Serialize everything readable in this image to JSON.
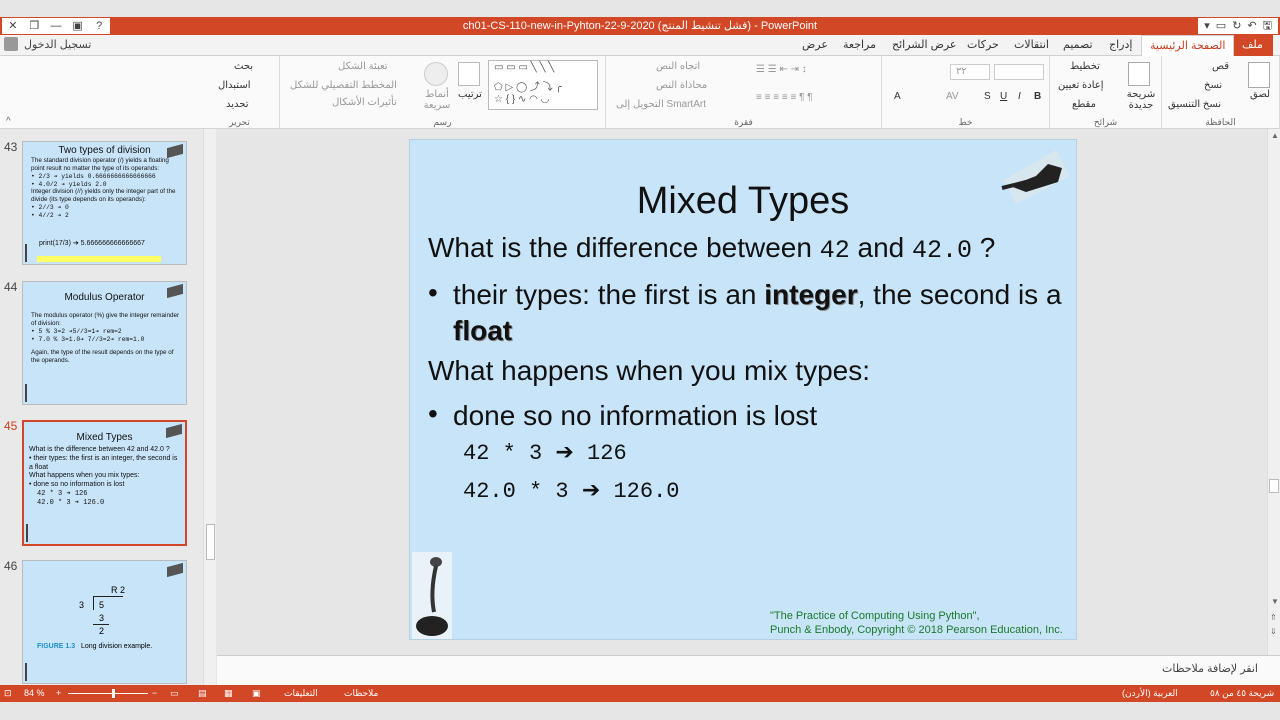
{
  "window": {
    "title": "ch01-CS-110-new-in-Pyhton-22-9-2020  (فشل تنشيط المنتج)  -  PowerPoint",
    "controls": [
      "✕",
      "❐",
      "—",
      "▢",
      "?"
    ]
  },
  "signin": "تسجيل الدخول",
  "tabs": {
    "file": "ملف",
    "home": "الصفحة الرئيسية",
    "insert": "إدراج",
    "design": "تصميم",
    "transitions": "انتقالات",
    "animations": "حركات",
    "slideshow": "عرض الشرائح",
    "review": "مراجعة",
    "view": "عرض"
  },
  "ribbon": {
    "clipboard": {
      "label": "الحافظة",
      "paste": "لصق",
      "cut": "قص",
      "copy": "نسخ",
      "format_painter": "نسخ التنسيق"
    },
    "slides": {
      "label": "شرائح",
      "new_slide": "شريحة جديدة",
      "layout": "تخطيط",
      "reset": "إعادة تعيين",
      "section": "مقطع"
    },
    "font": {
      "label": "خط",
      "size": "٣٢"
    },
    "paragraph": {
      "label": "فقرة",
      "text_direction": "اتجاه النص",
      "align_text": "محاذاة النص",
      "smartart": "التحويل إلى SmartArt"
    },
    "drawing": {
      "label": "رسم",
      "arrange": "ترتيب",
      "quick_styles": "أنماط سريعة",
      "shape_fill": "تعبئة الشكل",
      "shape_outline": "المخطط التفصيلي للشكل",
      "shape_effects": "تأثيرات الأشكال"
    },
    "editing": {
      "label": "تحرير",
      "find": "بحث",
      "replace": "استبدال",
      "select": "تحديد"
    }
  },
  "thumbnails": [
    {
      "number": "43",
      "title": "Two types of division",
      "lines": [
        "The standard division operator (/) yields a floating point result no matter the type of its operands:",
        "• 2/3      ➔ yields 0.6666666666666666",
        "• 4.0/2    ➔ yields 2.0",
        "Integer division (//) yields only the integer part of the divide (its type depends on its operands):",
        "• 2//3     ➔ 0",
        "• 4//2     ➔ 2"
      ],
      "extra": "print(17/3)    ➔ 5.666666666666667"
    },
    {
      "number": "44",
      "title": "Modulus Operator",
      "lines": [
        "The modulus operator (%) give the integer remainder of division:",
        "• 5 % 3=2 ➔5//3=1➔ rem=2",
        "• 7.0 % 3=1.0➔ 7//3=2➔ rem=1.0",
        "Again, the type of the result depends on the type of the operands."
      ]
    },
    {
      "number": "45",
      "title": "Mixed Types",
      "lines": [
        "What is the difference between 42 and 42.0 ?",
        "• their types: the first is an integer, the second is a float",
        "What happens when you mix types:",
        "• done so no information is lost",
        "42 * 3 ➔ 126",
        "42.0 * 3 ➔ 126.0"
      ]
    },
    {
      "number": "46",
      "figure": {
        "remainder": "R 2",
        "divisor": "3",
        "dividend": "5",
        "sub": "3",
        "result": "2",
        "caption_bold": "FIGURE 1.3",
        "caption": "Long division example."
      }
    }
  ],
  "slide": {
    "title": "Mixed Types",
    "q1_pre": "What is the difference between ",
    "q1_a": "42",
    "q1_mid": " and ",
    "q1_b": "42.0",
    "q1_post": " ?",
    "b1_pre": "their types: the first is an ",
    "b1_bold1": "integer",
    "b1_mid": ", the second is a ",
    "b1_bold2": "float",
    "q2": "What happens when you mix types:",
    "b2": "done so no information is lost",
    "ex1_left": "42 * 3 ",
    "ex1_right": " 126",
    "ex2_left": "42.0 * 3 ",
    "ex2_right": " 126.0",
    "credit1": "\"The Practice of Computing Using Python\",",
    "credit2": "Punch & Enbody, Copyright © 2018 Pearson Education, Inc."
  },
  "notes_placeholder": "انقر لإضافة ملاحظات",
  "status": {
    "slide_position": "شريحة ٤٥ من ٥٨",
    "language": "العربية (الأردن)",
    "notes": "ملاحظات",
    "comments": "التعليقات",
    "zoom": "84 %"
  },
  "colors": {
    "accent": "#d24726",
    "slide_bg": "#c8e4f8",
    "credit_text": "#1a7a2a"
  }
}
